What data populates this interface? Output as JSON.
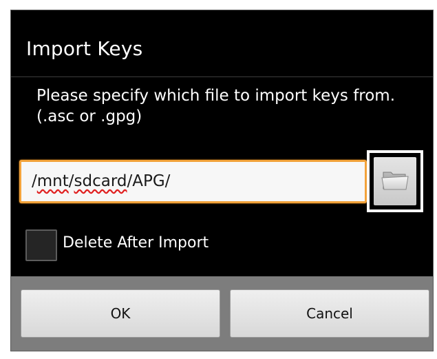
{
  "dialog": {
    "title": "Import Keys",
    "message": "Please specify which file to import keys from. (.asc or .gpg)"
  },
  "path_input": {
    "value_parts": [
      "/",
      "mnt",
      "/",
      "sdcard",
      "/APG/"
    ],
    "misspelled_parts": [
      "mnt",
      "sdcard"
    ],
    "value": "/mnt/sdcard/APG/"
  },
  "browse_button": {
    "icon": "folder-icon"
  },
  "delete_option": {
    "label": "Delete After Import",
    "checked": false
  },
  "buttons": {
    "ok_label": "OK",
    "cancel_label": "Cancel"
  },
  "colors": {
    "focus_border": "#f2a23a",
    "dialog_background": "#000000",
    "button_bar": "#7d7d7d",
    "spell_underline": "#e02020"
  }
}
